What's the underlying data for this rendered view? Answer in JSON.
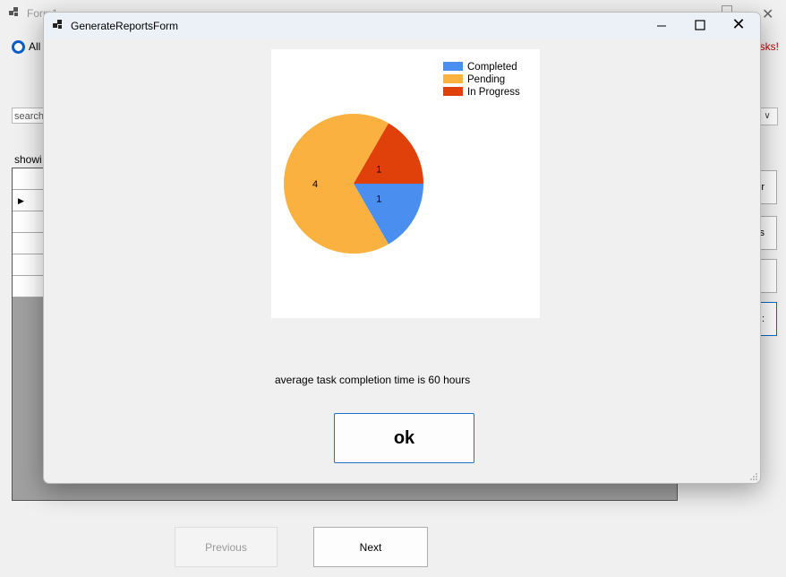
{
  "background": {
    "title": "Form1",
    "radio_label": "All",
    "warning_text": "asks!",
    "search_placeholder": "search",
    "showing_label": "showi",
    "side_buttons": [
      "r",
      "es",
      "",
      ":"
    ],
    "previous_label": "Previous",
    "next_label": "Next"
  },
  "dialog": {
    "title": "GenerateReportsForm",
    "average_text": "average task completion time is 60 hours",
    "ok_label": "ok"
  },
  "colors": {
    "completed": "#4a8ff0",
    "pending": "#fbb13f",
    "in_progress": "#e0410b",
    "focus_blue": "#1a73c6"
  },
  "chart_data": {
    "type": "pie",
    "categories": [
      "Completed",
      "Pending",
      "In Progress"
    ],
    "values": [
      1,
      4,
      1
    ],
    "labels": [
      "1",
      "4",
      "1"
    ],
    "colors": [
      "#4a8ff0",
      "#fbb13f",
      "#e0410b"
    ],
    "legend": "top-right"
  }
}
